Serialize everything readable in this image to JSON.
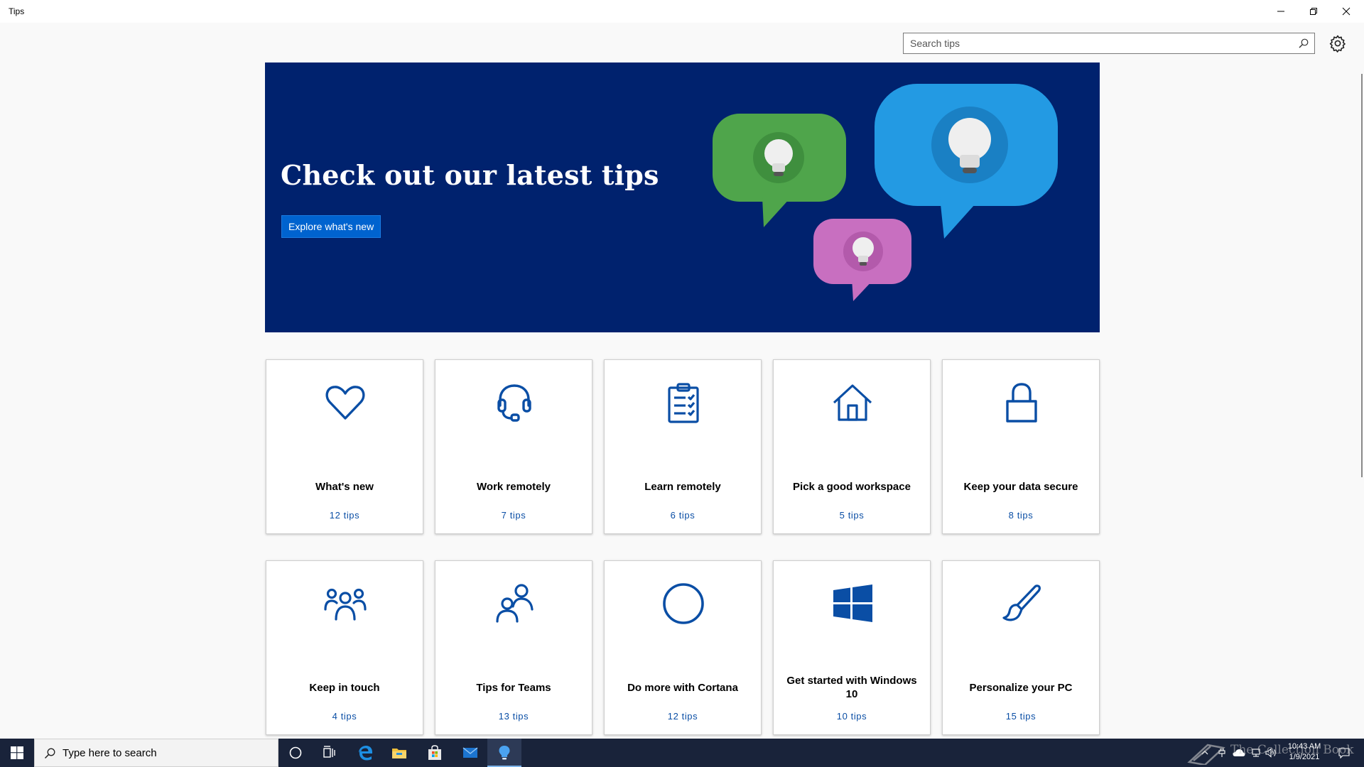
{
  "window": {
    "title": "Tips",
    "minimize_label": "Minimize",
    "restore_label": "Restore",
    "close_label": "Close"
  },
  "search": {
    "placeholder": "Search tips",
    "value": ""
  },
  "hero": {
    "title": "Check out our latest tips",
    "button_label": "Explore what's new",
    "colors": {
      "background": "#00226e",
      "button": "#0063cf",
      "bubble_green": "#4fa54b",
      "bubble_blue": "#239ae3",
      "bubble_pink": "#c86fc0"
    }
  },
  "cards": [
    {
      "title": "What's new",
      "count": "12 tips",
      "icon": "heart-icon"
    },
    {
      "title": "Work remotely",
      "count": "7 tips",
      "icon": "headset-icon"
    },
    {
      "title": "Learn remotely",
      "count": "6 tips",
      "icon": "clipboard-checklist-icon"
    },
    {
      "title": "Pick a good workspace",
      "count": "5 tips",
      "icon": "home-icon"
    },
    {
      "title": "Keep your data secure",
      "count": "8 tips",
      "icon": "lock-icon"
    },
    {
      "title": "Keep in touch",
      "count": "4 tips",
      "icon": "people-group-icon"
    },
    {
      "title": "Tips for Teams",
      "count": "13 tips",
      "icon": "people-pair-icon"
    },
    {
      "title": "Do more with Cortana",
      "count": "12 tips",
      "icon": "cortana-circle-icon"
    },
    {
      "title": "Get started with Windows 10",
      "count": "10 tips",
      "icon": "windows-logo-icon"
    },
    {
      "title": "Personalize your PC",
      "count": "15 tips",
      "icon": "paintbrush-icon"
    }
  ],
  "taskbar": {
    "search_placeholder": "Type here to search",
    "pinned": [
      "cortana-icon",
      "task-view-icon",
      "edge-icon",
      "file-explorer-icon",
      "store-icon",
      "mail-icon",
      "tips-icon"
    ],
    "active": "tips-icon",
    "clock_time": "10:43 AM",
    "clock_date": "1/9/2021",
    "watermark": "The Collection Book"
  },
  "colors": {
    "accent": "#0a4ea5",
    "page_background": "#f9f9f9",
    "taskbar": "#19233a"
  }
}
